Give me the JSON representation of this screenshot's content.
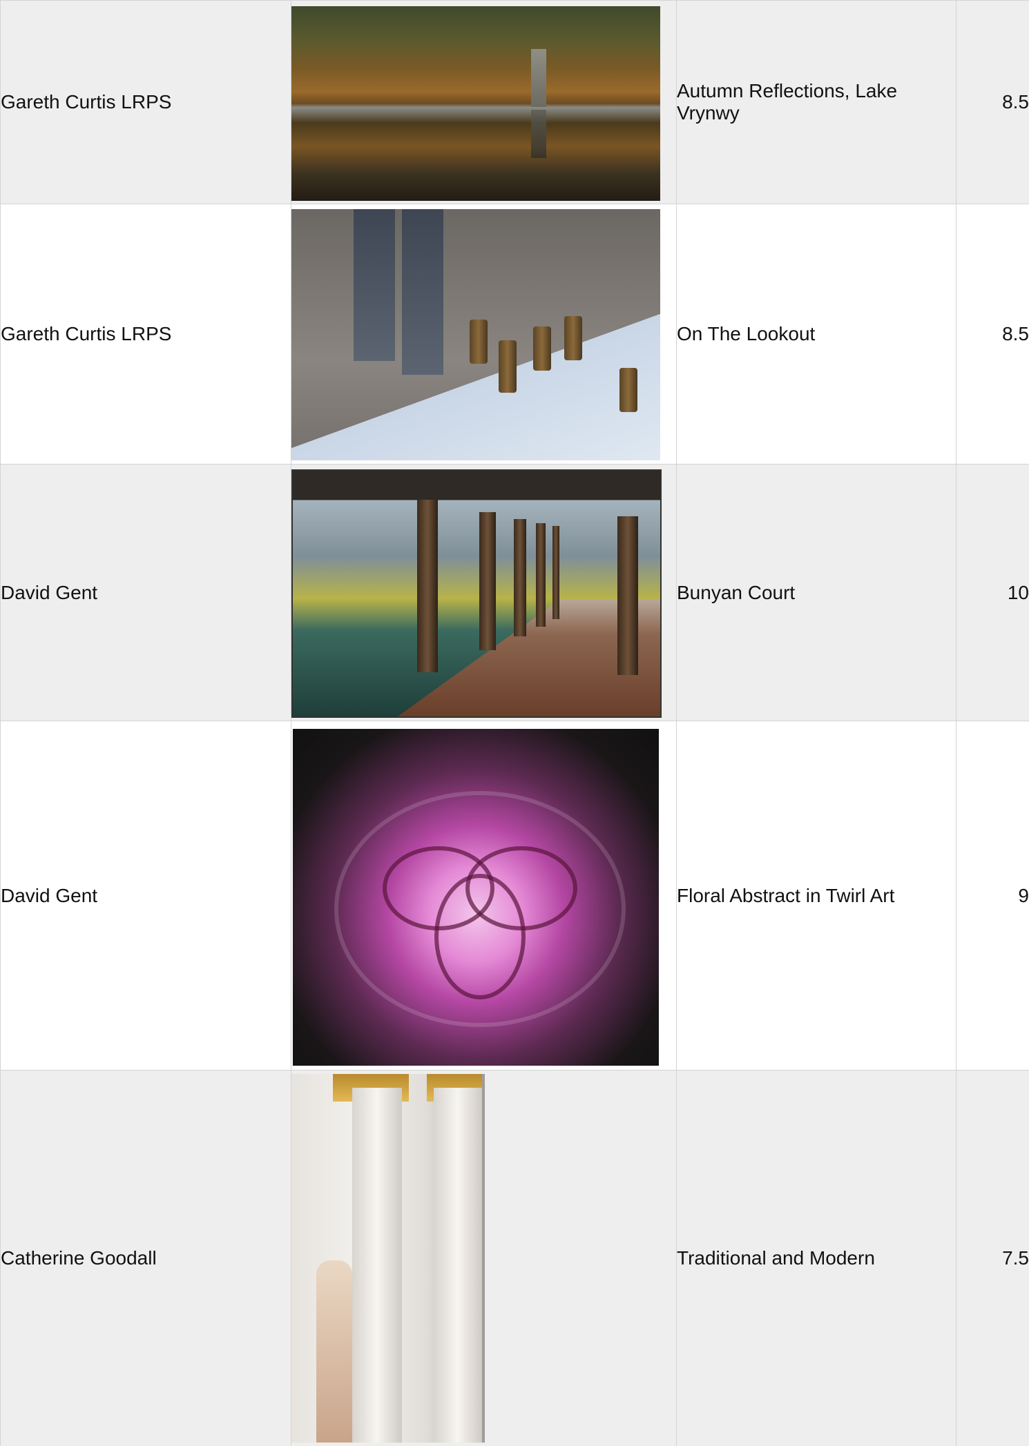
{
  "rows": [
    {
      "author": "Gareth Curtis LRPS",
      "image_icon": "photo-autumn-lake",
      "title": "Autumn Reflections, Lake Vrynwy",
      "score": "8.5"
    },
    {
      "author": "Gareth Curtis LRPS",
      "image_icon": "photo-graffiti-cans",
      "title": "On The Lookout",
      "score": "8.5"
    },
    {
      "author": "David Gent",
      "image_icon": "photo-colonnade",
      "title": "Bunyan Court",
      "score": "10"
    },
    {
      "author": "David Gent",
      "image_icon": "photo-twirl-abstract",
      "title": "Floral Abstract in Twirl Art",
      "score": "9"
    },
    {
      "author": "Catherine Goodall",
      "image_icon": "photo-mosque-columns",
      "title": "Traditional and Modern",
      "score": "7.5"
    }
  ],
  "colors": {
    "row_shade": "#eeeeee",
    "row_plain": "#ffffff",
    "border": "#d3d3d3",
    "text": "#111111"
  }
}
